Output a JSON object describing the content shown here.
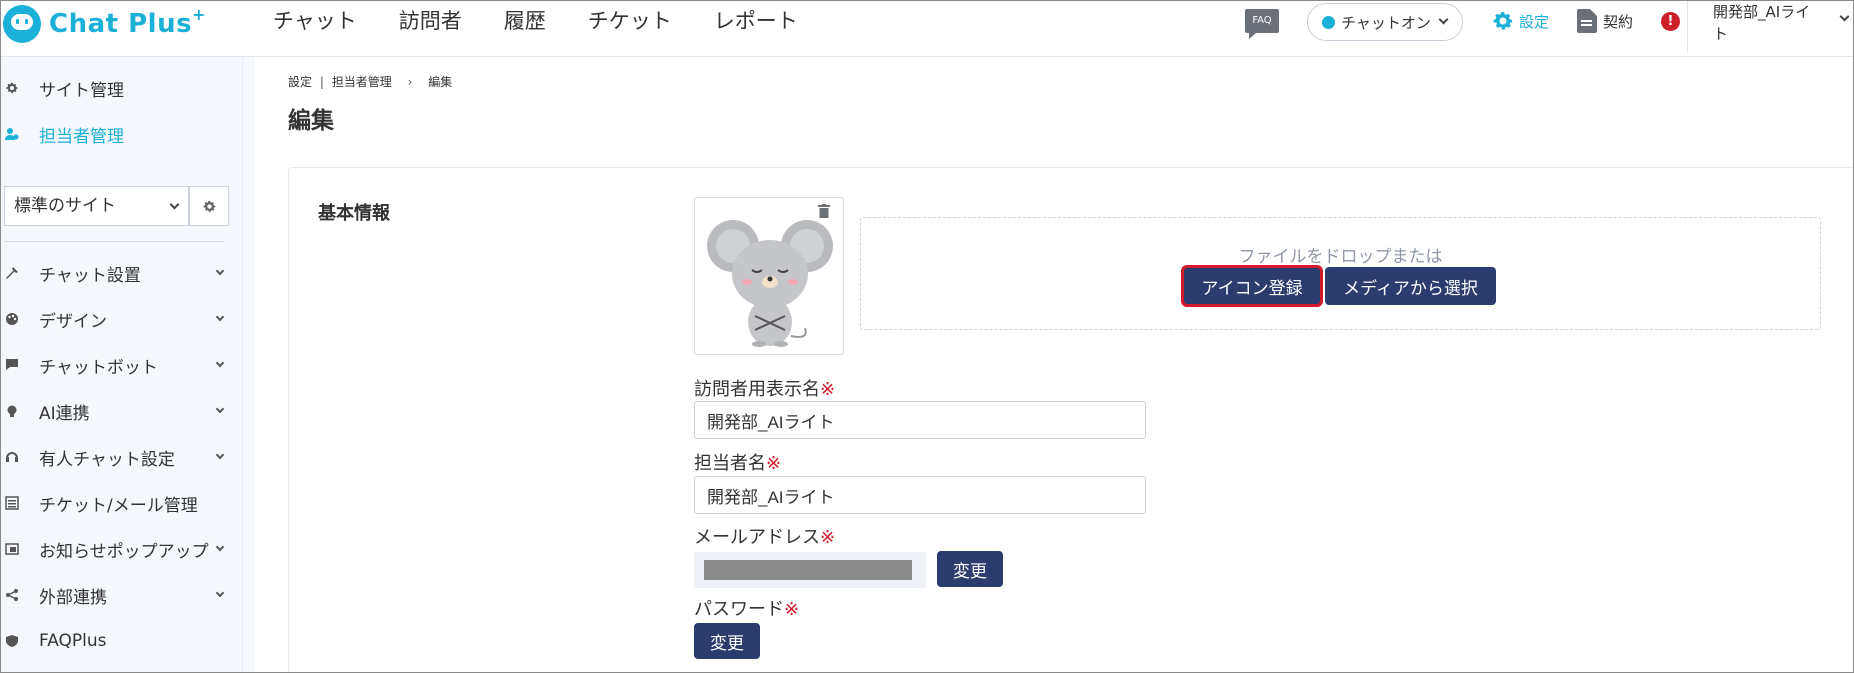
{
  "header": {
    "logo_text": "Chat Plus",
    "logo_plus": "+",
    "nav": [
      "チャット",
      "訪問者",
      "履歴",
      "チケット",
      "レポート"
    ],
    "faq_label": "FAQ",
    "chat_status": "チャットオン",
    "settings_label": "設定",
    "contract_label": "契約",
    "alert_label": "!",
    "user_name": "開発部_AIライト"
  },
  "sidebar": {
    "top_items": [
      {
        "label": "サイト管理",
        "icon": "gear-small-icon"
      },
      {
        "label": "担当者管理",
        "icon": "user-gear-icon",
        "active": true
      }
    ],
    "site_select_value": "標準のサイト",
    "menu": [
      {
        "label": "チャット設置",
        "icon": "tools-icon"
      },
      {
        "label": "デザイン",
        "icon": "palette-icon"
      },
      {
        "label": "チャットボット",
        "icon": "chat-bubble-icon"
      },
      {
        "label": "AI連携",
        "icon": "bulb-icon"
      },
      {
        "label": "有人チャット設定",
        "icon": "headset-icon"
      },
      {
        "label": "チケット/メール管理",
        "icon": "ticket-icon"
      },
      {
        "label": "お知らせポップアップ",
        "icon": "popup-icon"
      },
      {
        "label": "外部連携",
        "icon": "share-icon"
      },
      {
        "label": "FAQPlus",
        "icon": "shield-icon"
      }
    ]
  },
  "main": {
    "breadcrumb": [
      "設定",
      "担当者管理",
      "編集"
    ],
    "breadcrumb_divider": "|",
    "breadcrumb_chevron": "›",
    "title": "編集",
    "section_title": "基本情報",
    "dropzone_text": "ファイルをドロップまたは",
    "register_icon_button": "アイコン登録",
    "select_media_button": "メディアから選択",
    "visitor_display_name_label": "訪問者用表示名",
    "visitor_display_name_value": "開発部_AIライト",
    "staff_name_label": "担当者名",
    "staff_name_value": "開発部_AIライト",
    "email_label": "メールアドレス",
    "email_change_button": "変更",
    "password_label": "パスワード",
    "password_change_button": "変更",
    "required_mark": "※"
  },
  "colors": {
    "accent": "#1ab0d8",
    "button": "#2b3d6e",
    "required": "#d21a2a",
    "highlight": "#d21a2a"
  }
}
